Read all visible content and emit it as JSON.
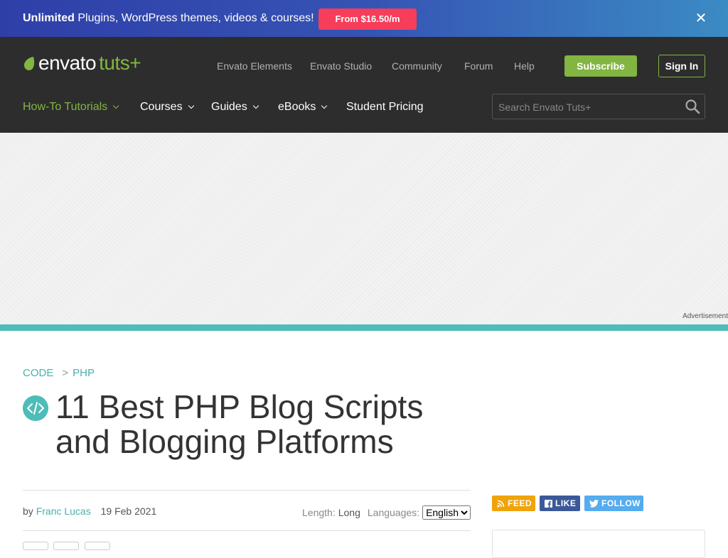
{
  "promo": {
    "bold": "Unlimited",
    "text": " Plugins, WordPress themes, videos & courses!",
    "button": "From $16.50/m",
    "close_glyph": "✕"
  },
  "header": {
    "logo_word": "envato",
    "logo_suffix": "tuts+",
    "top_links": [
      "Envato Elements",
      "Envato Studio",
      "Community",
      "Forum",
      "Help"
    ],
    "subscribe": "Subscribe",
    "sign_in": "Sign In",
    "main_nav": [
      {
        "label": "How-To Tutorials",
        "has_dropdown": true,
        "active": true
      },
      {
        "label": "Courses",
        "has_dropdown": true,
        "active": false
      },
      {
        "label": "Guides",
        "has_dropdown": true,
        "active": false
      },
      {
        "label": "eBooks",
        "has_dropdown": true,
        "active": false
      },
      {
        "label": "Student Pricing",
        "has_dropdown": false,
        "active": false
      }
    ],
    "search_placeholder": "Search Envato Tuts+"
  },
  "ad": {
    "label": "Advertisement"
  },
  "article": {
    "breadcrumb": [
      "CODE",
      "PHP"
    ],
    "breadcrumb_sep": ">",
    "title": "11 Best PHP Blog Scripts and Blogging Platforms",
    "by": "by",
    "author": "Franc Lucas",
    "date": "19 Feb 2021",
    "length_label": "Length:",
    "length_value": "Long",
    "languages_label": "Languages:",
    "language_selected": "English"
  },
  "social": {
    "feed": "FEED",
    "like": "LIKE",
    "follow": "FOLLOW"
  },
  "colors": {
    "accent_green": "#82b541",
    "teal": "#4ebcb8",
    "promo_button": "#f63d5a",
    "header_bg": "#2d2d2d"
  }
}
